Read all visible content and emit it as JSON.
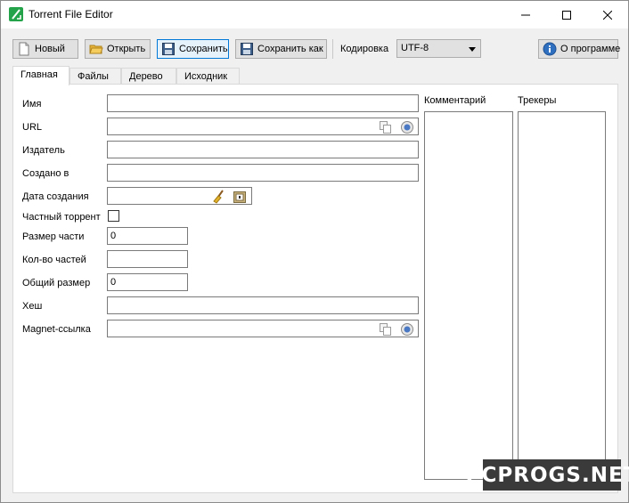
{
  "window": {
    "title": "Torrent File Editor"
  },
  "toolbar": {
    "new_label": "Новый",
    "open_label": "Открыть",
    "save_label": "Сохранить",
    "save_as_label": "Сохранить как",
    "encoding_label": "Кодировка",
    "encoding_value": "UTF-8",
    "about_label": "О программе"
  },
  "tabs": [
    {
      "label": "Главная",
      "active": true
    },
    {
      "label": "Файлы",
      "active": false
    },
    {
      "label": "Дерево",
      "active": false
    },
    {
      "label": "Исходник",
      "active": false
    }
  ],
  "fields": {
    "name": {
      "label": "Имя",
      "value": ""
    },
    "url": {
      "label": "URL",
      "value": ""
    },
    "publisher": {
      "label": "Издатель",
      "value": ""
    },
    "created_by": {
      "label": "Создано в",
      "value": ""
    },
    "creation_date": {
      "label": "Дата создания",
      "value": ""
    },
    "private": {
      "label": "Частный торрент",
      "checked": false
    },
    "piece_size": {
      "label": "Размер части",
      "value": "0"
    },
    "piece_count": {
      "label": "Кол-во частей",
      "value": ""
    },
    "total_size": {
      "label": "Общий размер",
      "value": "0"
    },
    "hash": {
      "label": "Хеш",
      "value": ""
    },
    "magnet": {
      "label": "Magnet-ссылка",
      "value": ""
    }
  },
  "comment": {
    "label": "Комментарий"
  },
  "trackers": {
    "label": "Трекеры"
  },
  "watermark": {
    "text": "PCPROGS.NET"
  }
}
